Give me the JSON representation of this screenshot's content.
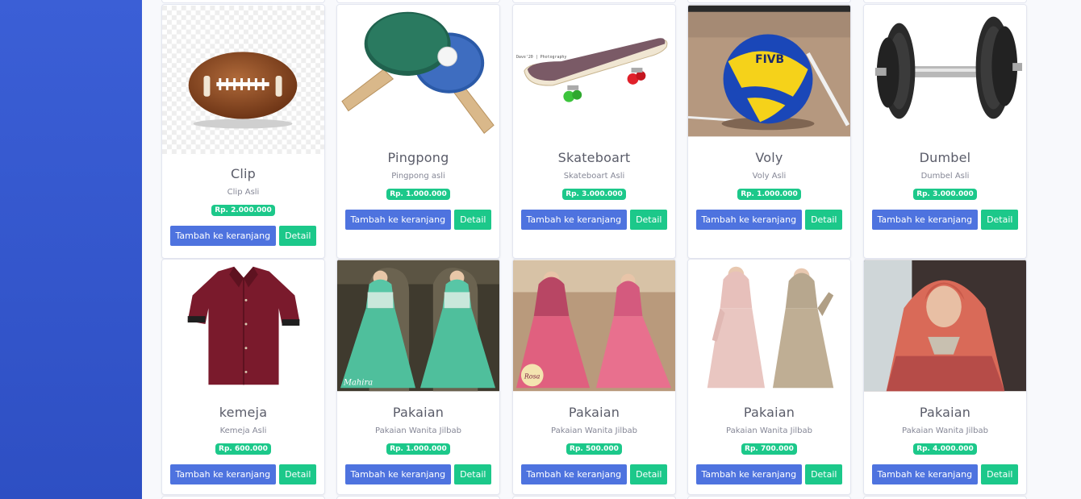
{
  "products": [
    {
      "name": "Clip",
      "desc": "Clip Asli",
      "price": "Rp. 2.000.000",
      "cart_label": "Tambah ke keranjang",
      "detail_label": "Detail",
      "image": "football"
    },
    {
      "name": "Pingpong",
      "desc": "Pingpong asli",
      "price": "Rp. 1.000.000",
      "cart_label": "Tambah ke keranjang",
      "detail_label": "Detail",
      "image": "pingpong"
    },
    {
      "name": "Skateboart",
      "desc": "Skateboart Asli",
      "price": "Rp. 3.000.000",
      "cart_label": "Tambah ke keranjang",
      "detail_label": "Detail",
      "image": "skateboard",
      "image_caption": "Dave'20 | Photography"
    },
    {
      "name": "Voly",
      "desc": "Voly Asli",
      "price": "Rp. 1.000.000",
      "cart_label": "Tambah ke keranjang",
      "detail_label": "Detail",
      "image": "volleyball",
      "image_caption": "FIVB"
    },
    {
      "name": "Dumbel",
      "desc": "Dumbel Asli",
      "price": "Rp. 3.000.000",
      "cart_label": "Tambah ke keranjang",
      "detail_label": "Detail",
      "image": "dumbbell"
    },
    {
      "name": "kemeja",
      "desc": "Kemeja Asli",
      "price": "Rp. 600.000",
      "cart_label": "Tambah ke keranjang",
      "detail_label": "Detail",
      "image": "shirt"
    },
    {
      "name": "Pakaian",
      "desc": "Pakaian Wanita Jilbab",
      "price": "Rp. 1.000.000",
      "cart_label": "Tambah ke keranjang",
      "detail_label": "Detail",
      "image": "dress-green",
      "image_caption": "Mahira"
    },
    {
      "name": "Pakaian",
      "desc": "Pakaian Wanita Jilbab",
      "price": "Rp. 500.000",
      "cart_label": "Tambah ke keranjang",
      "detail_label": "Detail",
      "image": "dress-pink",
      "image_caption": "Rosa"
    },
    {
      "name": "Pakaian",
      "desc": "Pakaian Wanita Jilbab",
      "price": "Rp. 700.000",
      "cart_label": "Tambah ke keranjang",
      "detail_label": "Detail",
      "image": "dress-beige"
    },
    {
      "name": "Pakaian",
      "desc": "Pakaian Wanita Jilbab",
      "price": "Rp. 4.000.000",
      "cart_label": "Tambah ke keranjang",
      "detail_label": "Detail",
      "image": "hijab-coral"
    }
  ],
  "colors": {
    "sidebar": "#3b5fd6",
    "primary": "#4e73df",
    "success": "#1cc88a"
  }
}
